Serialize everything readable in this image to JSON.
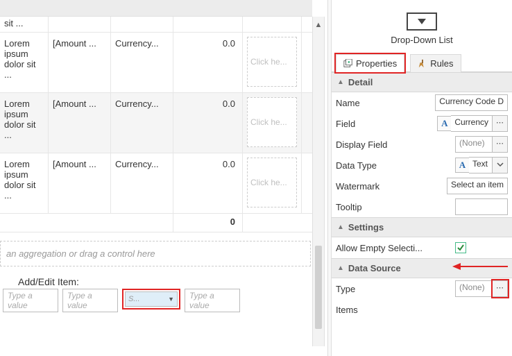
{
  "left": {
    "grid": {
      "short_row_first_cell": "sit ...",
      "rows": [
        {
          "c1": "Lorem ipsum dolor sit ...",
          "c2": "[Amount ...",
          "c3": "Currency...",
          "c4": "0.0",
          "placeholder": "Click he..."
        },
        {
          "c1": "Lorem ipsum dolor sit ...",
          "c2": "[Amount ...",
          "c3": "Currency...",
          "c4": "0.0",
          "placeholder": "Click he..."
        },
        {
          "c1": "Lorem ipsum dolor sit ...",
          "c2": "[Amount ...",
          "c3": "Currency...",
          "c4": "0.0",
          "placeholder": "Click he..."
        }
      ],
      "total": "0"
    },
    "aggregation_text": "an aggregation or drag a control here",
    "add_edit_label": "Add/Edit Item:",
    "add_edit": {
      "p1": "Type a value",
      "p2": "Type a value",
      "select": "S...",
      "p4": "Type a value"
    }
  },
  "right": {
    "object_title": "Drop-Down List",
    "tabs": {
      "properties": "Properties",
      "rules": "Rules"
    },
    "sections": {
      "detail": "Detail",
      "settings": "Settings",
      "data_source": "Data Source"
    },
    "detail": {
      "name_label": "Name",
      "name_value": "Currency Code D",
      "field_label": "Field",
      "field_value": "Currency",
      "display_field_label": "Display Field",
      "display_field_value": "(None)",
      "data_type_label": "Data Type",
      "data_type_value": "Text",
      "watermark_label": "Watermark",
      "watermark_value": "Select an item",
      "tooltip_label": "Tooltip",
      "tooltip_value": ""
    },
    "settings": {
      "allow_empty_label": "Allow Empty Selecti...",
      "allow_empty_checked": true
    },
    "data_source": {
      "type_label": "Type",
      "type_value": "(None)",
      "items_label": "Items"
    }
  }
}
